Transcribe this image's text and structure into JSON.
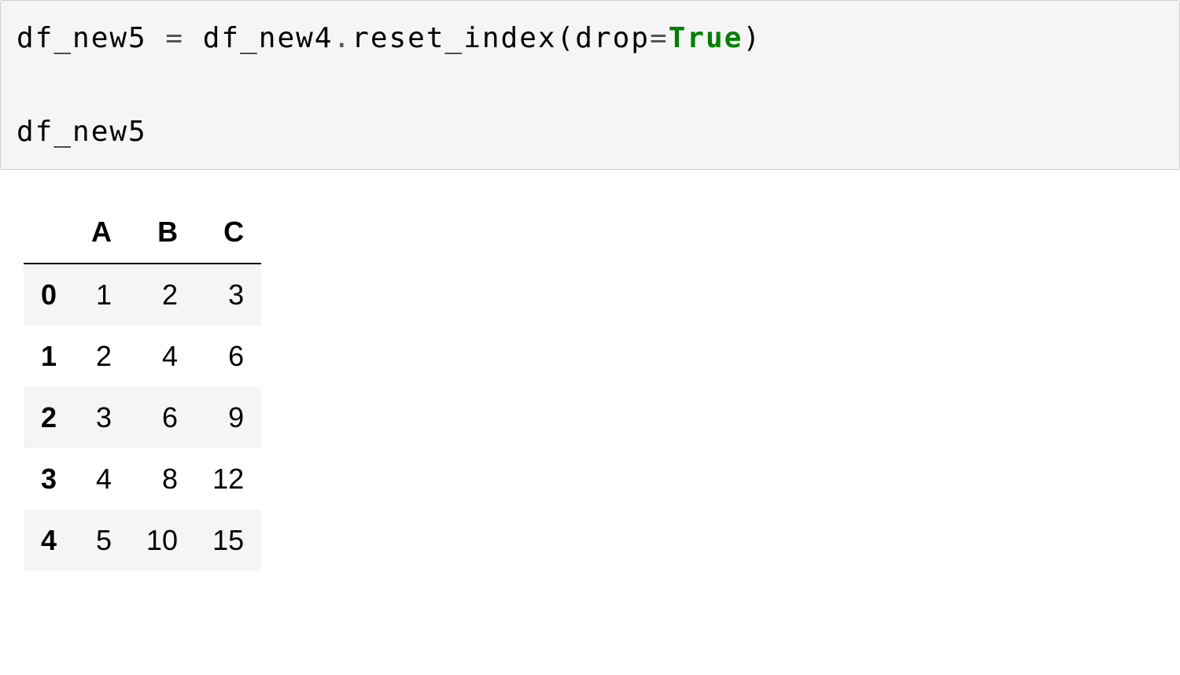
{
  "code": {
    "line1_part1": "df_new5 ",
    "line1_eq": "=",
    "line1_part2": " df_new4",
    "line1_dot": ".",
    "line1_part3": "reset_index(drop",
    "line1_eq2": "=",
    "line1_true": "True",
    "line1_part4": ")",
    "line2": "df_new5"
  },
  "chart_data": {
    "type": "table",
    "columns": [
      "A",
      "B",
      "C"
    ],
    "index": [
      "0",
      "1",
      "2",
      "3",
      "4"
    ],
    "data": [
      [
        "1",
        "2",
        "3"
      ],
      [
        "2",
        "4",
        "6"
      ],
      [
        "3",
        "6",
        "9"
      ],
      [
        "4",
        "8",
        "12"
      ],
      [
        "5",
        "10",
        "15"
      ]
    ]
  }
}
